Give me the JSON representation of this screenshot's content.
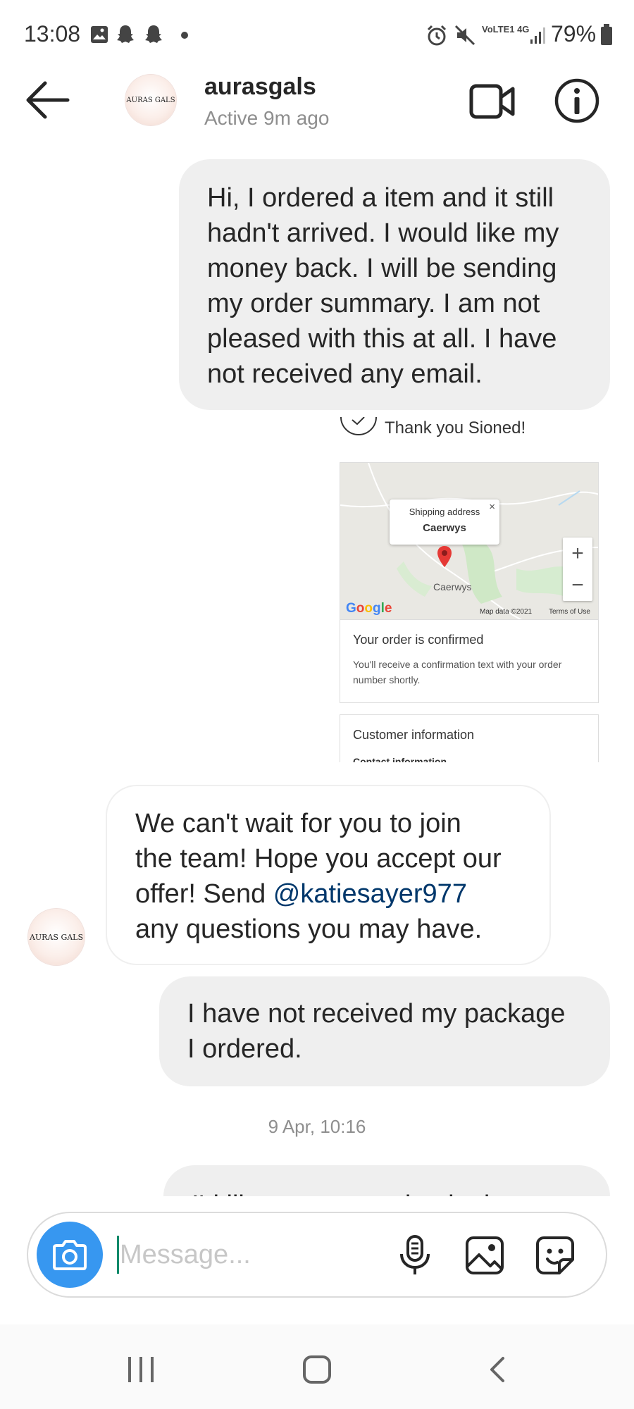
{
  "status_bar": {
    "time": "13:08",
    "network": "VoLTE1 4G",
    "battery": "79%"
  },
  "header": {
    "avatar_text": "AURAS GALS",
    "username": "aurasgals",
    "status": "Active 9m ago",
    "icons": [
      "back-arrow-icon",
      "video-camera-icon",
      "info-icon"
    ]
  },
  "messages": {
    "m1": {
      "lines": [
        "Hi, I ordered a item and it still",
        "hadn't arrived. I would like my",
        "money back. I will be sending",
        "my order summary. I am not",
        "pleased with this at all. I have",
        "not received any email."
      ]
    },
    "shared_image": {
      "thanks": "Thank you Sioned!",
      "popup_title": "Shipping address",
      "popup_place": "Caerwys",
      "map_label": "Caerwys",
      "google": "Google",
      "map_data": "Map data ©2021",
      "terms": "Terms of Use",
      "confirmed_title": "Your order is confirmed",
      "confirmed_text": "You'll receive a confirmation text with your order number shortly.",
      "customer_info": "Customer information",
      "contact_info": "Contact information"
    },
    "m2": {
      "line1": "We can't wait for you to join",
      "line2": "the team! Hope you accept our",
      "line3_pre": "offer! Send ",
      "mention": "@katiesayer977",
      "line4": "any questions you may have."
    },
    "m3": {
      "lines": [
        "I have not received my package",
        "I ordered."
      ]
    },
    "timestamp": "9 Apr, 10:16",
    "m4": {
      "partial_text": "I'd like my money back please"
    }
  },
  "composer": {
    "placeholder": "Message...",
    "icons": [
      "camera-icon",
      "microphone-icon",
      "gallery-icon",
      "sticker-icon"
    ]
  },
  "colors": {
    "accent": "#3797f0",
    "outgoing_bubble": "#efefef",
    "mention": "#00376b",
    "secondary_text": "#8e8e8e"
  }
}
